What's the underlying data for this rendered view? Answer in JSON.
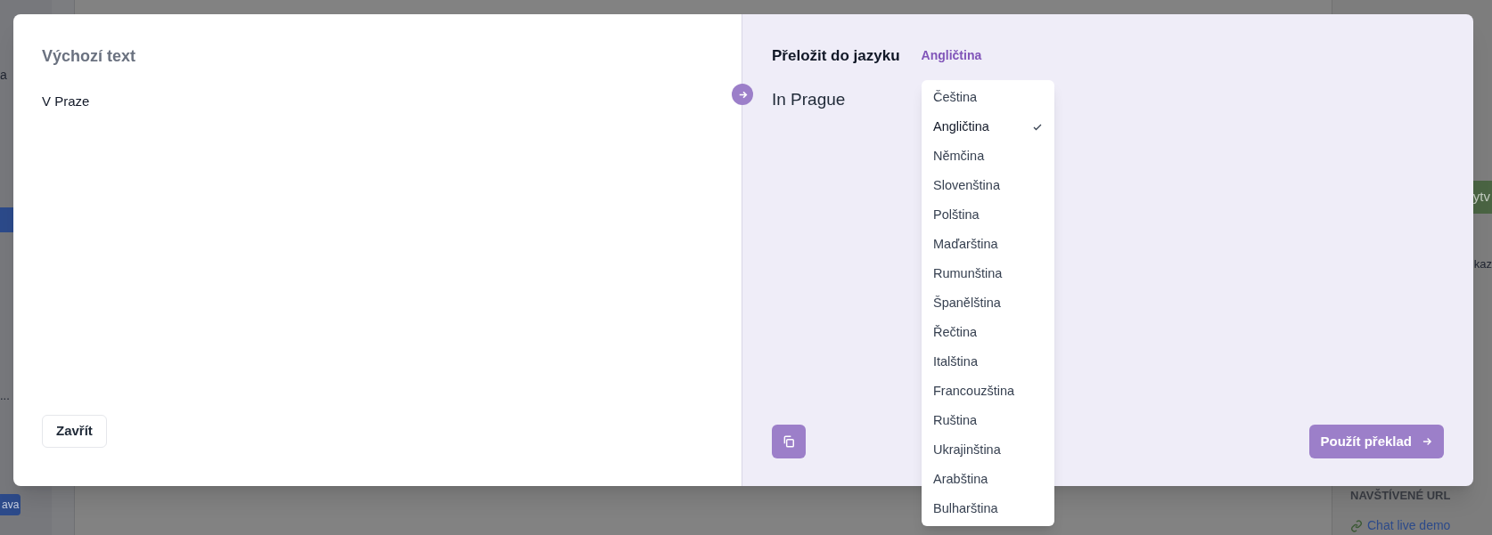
{
  "background": {
    "sidebar": {
      "item_fragment": "a",
      "ellipsis": "...",
      "badge": "ava"
    },
    "right_panel": {
      "button_fragment": "ytv",
      "text_fragment": "kaz",
      "section_title": "NAVŠTÍVENÉ URL",
      "link": "Chat live demo"
    }
  },
  "dialog": {
    "source": {
      "title": "Výchozí text",
      "text": "V Praze",
      "close_button": "Zavřít"
    },
    "target": {
      "title": "Přeložit do jazyku",
      "language": "Angličtina",
      "text": "In Prague",
      "apply_button": "Použít překlad"
    },
    "language_menu": [
      {
        "label": "Čeština",
        "selected": false
      },
      {
        "label": "Angličtina",
        "selected": true
      },
      {
        "label": "Němčina",
        "selected": false
      },
      {
        "label": "Slovenština",
        "selected": false
      },
      {
        "label": "Polština",
        "selected": false
      },
      {
        "label": "Maďarština",
        "selected": false
      },
      {
        "label": "Rumunština",
        "selected": false
      },
      {
        "label": "Španělština",
        "selected": false
      },
      {
        "label": "Řečtina",
        "selected": false
      },
      {
        "label": "Italština",
        "selected": false
      },
      {
        "label": "Francouzština",
        "selected": false
      },
      {
        "label": "Ruština",
        "selected": false
      },
      {
        "label": "Ukrajinština",
        "selected": false
      },
      {
        "label": "Arabština",
        "selected": false
      },
      {
        "label": "Bulharština",
        "selected": false
      }
    ]
  }
}
